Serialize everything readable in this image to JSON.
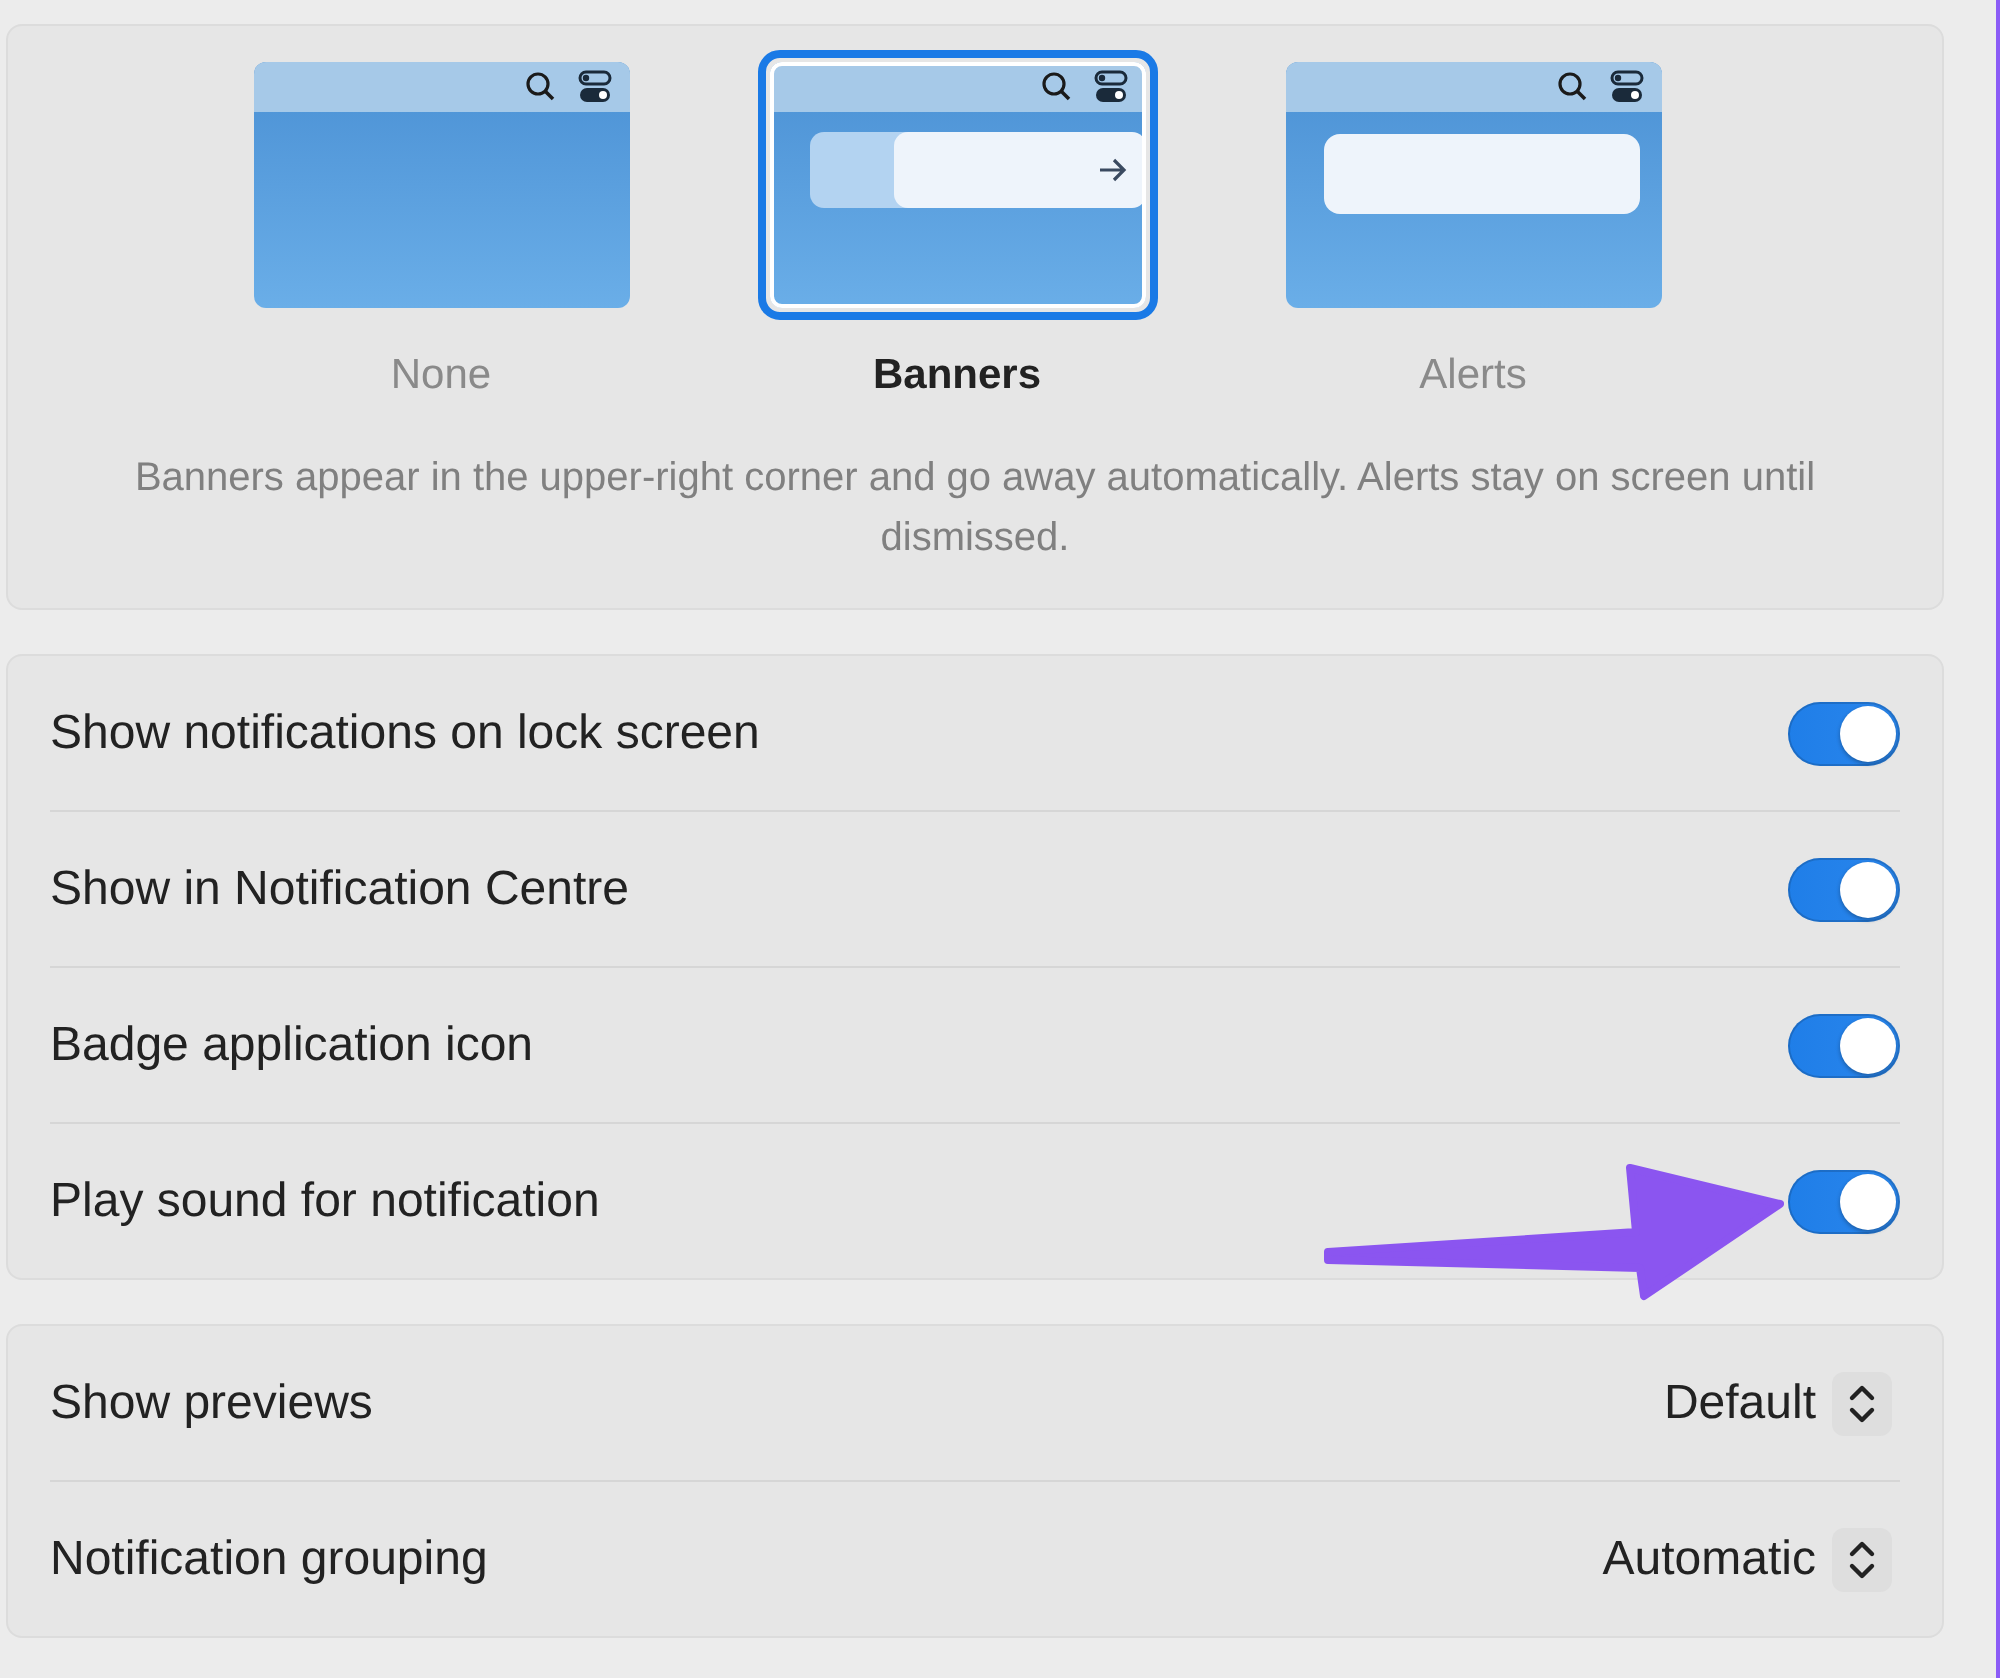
{
  "styles": [
    {
      "label": "None",
      "kind": "none",
      "selected": false
    },
    {
      "label": "Banners",
      "kind": "banner",
      "selected": true
    },
    {
      "label": "Alerts",
      "kind": "alert",
      "selected": false
    }
  ],
  "description": "Banners appear in the upper-right corner and go away automatically. Alerts stay on screen until dismissed.",
  "toggles": [
    {
      "label": "Show notifications on lock screen",
      "on": true
    },
    {
      "label": "Show in Notification Centre",
      "on": true
    },
    {
      "label": "Badge application icon",
      "on": true
    },
    {
      "label": "Play sound for notification",
      "on": true
    }
  ],
  "selects": [
    {
      "label": "Show previews",
      "value": "Default"
    },
    {
      "label": "Notification grouping",
      "value": "Automatic"
    }
  ]
}
